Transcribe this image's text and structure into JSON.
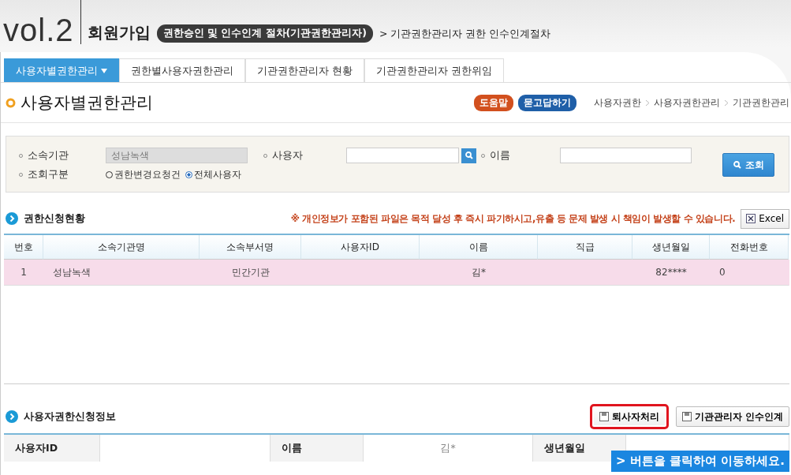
{
  "header": {
    "volume": "vol.2",
    "title": "회원가입",
    "badge": "권한승인 및 인수인계 절차(기관권한관리자)",
    "subtitle": "> 기관권한관리자 권한 인수인계절차"
  },
  "tabs": [
    {
      "label": "사용자별권한관리",
      "selected": true,
      "dropdown": true
    },
    {
      "label": "권한별사용자권한관리",
      "selected": false,
      "dropdown": false
    },
    {
      "label": "기관권한관리자 현황",
      "selected": false,
      "dropdown": false
    },
    {
      "label": "기관권한관리자 권한위임",
      "selected": false,
      "dropdown": false
    }
  ],
  "page_title": "사용자별권한관리",
  "help_buttons": [
    {
      "label": "도움말",
      "color": "#d2501e"
    },
    {
      "label": "묻고답하기",
      "color": "#1f5fa8"
    }
  ],
  "breadcrumb": [
    "사용자권한",
    "사용자권한관리",
    "기관권한관리"
  ],
  "search": {
    "org_label": "소속기관",
    "org_value": "성남녹색",
    "user_label": "사용자",
    "name_label": "이름",
    "query_label": "조회구분",
    "options": [
      {
        "label": "권한변경요청건",
        "selected": false
      },
      {
        "label": "전체사용자",
        "selected": true
      }
    ],
    "search_button": "조회"
  },
  "requests": {
    "title": "권한신청현황",
    "notice": "※ 개인정보가 포함된 파일은 목적 달성 후 즉시 파기하시고,유출 등 문제 발생 시 책임이 발생할 수 있습니다.",
    "excel_button": "Excel",
    "columns": [
      "번호",
      "소속기관명",
      "소속부서명",
      "사용자ID",
      "이름",
      "직급",
      "생년월일",
      "전화번호"
    ],
    "rows": [
      {
        "selected": true,
        "cells": [
          "1",
          "성남녹색",
          "민간기관",
          "",
          "김*",
          "",
          "82****",
          "0"
        ]
      }
    ]
  },
  "detail": {
    "title": "사용자권한신청정보",
    "buttons": [
      {
        "label": "퇴사자처리",
        "highlighted": true
      },
      {
        "label": "기관관리자 인수인계",
        "highlighted": false
      }
    ],
    "fields": [
      {
        "label": "사용자ID"
      },
      {
        "label": "이름",
        "value": "김*"
      },
      {
        "label": "생년월일"
      }
    ]
  },
  "tooltip": "> 버튼을 클릭하여 이동하세요."
}
